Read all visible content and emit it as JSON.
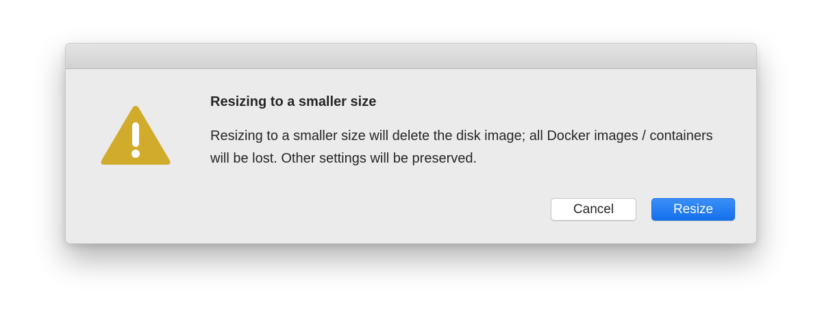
{
  "dialog": {
    "title": "Resizing to a smaller size",
    "message": "Resizing to a smaller size will delete the disk image; all Docker images / containers will be lost. Other settings will be preserved.",
    "icon": "warning-icon"
  },
  "buttons": {
    "cancel_label": "Cancel",
    "resize_label": "Resize"
  },
  "colors": {
    "warning_icon": "#d1ac2c",
    "primary_button": "#1f7cf1",
    "dialog_background": "#ebebeb"
  }
}
